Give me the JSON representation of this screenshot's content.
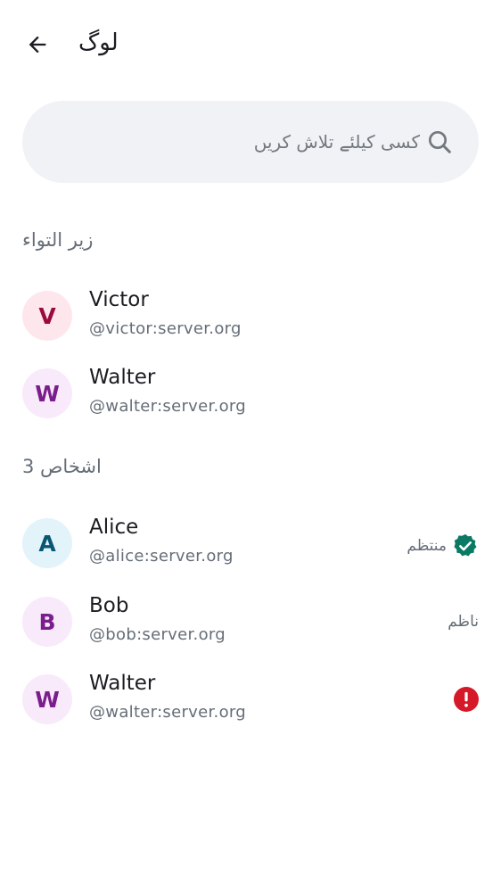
{
  "header": {
    "title": "لوگ",
    "back_icon": "arrow-left-icon"
  },
  "search": {
    "placeholder": "کسی کیلئے تلاش کریں",
    "icon": "search-icon"
  },
  "pending_section": {
    "title": "زیر التواء",
    "members": [
      {
        "initial": "V",
        "name": "Victor",
        "handle": "@victor:server.org",
        "avatar_bg": "#fde7ec",
        "avatar_fg": "#9b0a3f"
      },
      {
        "initial": "W",
        "name": "Walter",
        "handle": "@walter:server.org",
        "avatar_bg": "#f8eafa",
        "avatar_fg": "#7b1d8c"
      }
    ]
  },
  "people_section": {
    "title": "3 اشخاص",
    "members": [
      {
        "initial": "A",
        "name": "Alice",
        "handle": "@alice:server.org",
        "avatar_bg": "#e3f3fa",
        "avatar_fg": "#085673",
        "role": "منتظم",
        "role_icon": "verified-badge-icon",
        "role_color": "#0b7a64"
      },
      {
        "initial": "B",
        "name": "Bob",
        "handle": "@bob:server.org",
        "avatar_bg": "#f8eafa",
        "avatar_fg": "#7b1d8c",
        "role": "ناظم"
      },
      {
        "initial": "W",
        "name": "Walter",
        "handle": "@walter:server.org",
        "avatar_bg": "#f8eafa",
        "avatar_fg": "#7b1d8c",
        "status_icon": "error-icon",
        "status_color": "#d51928"
      }
    ]
  }
}
